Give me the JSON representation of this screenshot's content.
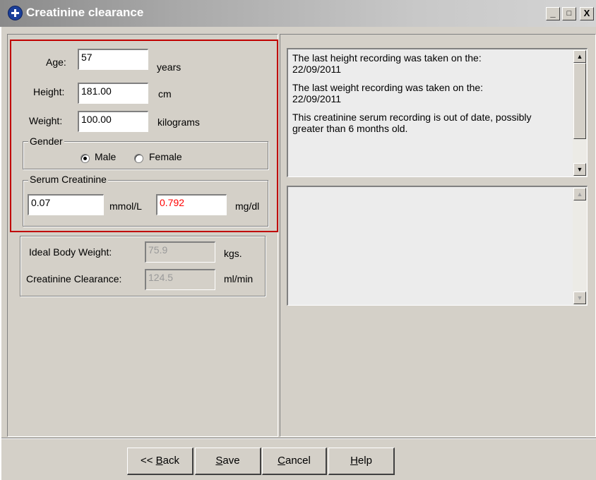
{
  "window": {
    "title": "Creatinine clearance",
    "controls": {
      "minimize": "_",
      "maximize": "□",
      "close": "X"
    }
  },
  "patient": {
    "age_label": "Age:",
    "age_value": "57",
    "age_unit": "years",
    "height_label": "Height:",
    "height_value": "181.00",
    "height_unit": "cm",
    "weight_label": "Weight:",
    "weight_value": "100.00",
    "weight_unit": "kilograms"
  },
  "gender": {
    "title": "Gender",
    "options": [
      "Male",
      "Female"
    ],
    "selected": "Male"
  },
  "serum": {
    "title": "Serum Creatinine",
    "mmol_value": "0.07",
    "mmol_unit": "mmol/L",
    "mg_value": "0.792",
    "mg_unit": "mg/dl",
    "mg_value_color": "#ff0000"
  },
  "results": {
    "ibw_label": "Ideal Body Weight:",
    "ibw_value": "75.9",
    "ibw_unit": "kgs.",
    "crcl_label": "Creatinine Clearance:",
    "crcl_value": "124.5",
    "crcl_unit": "ml/min"
  },
  "messages": {
    "line1": "The last height recording was taken on the:",
    "line1_date": "22/09/2011",
    "line2": "The last weight recording was taken on the:",
    "line2_date": "22/09/2011",
    "line3": "This creatinine serum recording is out of date, possibly greater than 6 months old."
  },
  "buttons": {
    "back": {
      "prefix": "<< ",
      "accel": "B",
      "rest": "ack"
    },
    "save": {
      "prefix": "",
      "accel": "S",
      "rest": "ave"
    },
    "cancel": {
      "prefix": "",
      "accel": "C",
      "rest": "ancel"
    },
    "help": {
      "prefix": "",
      "accel": "H",
      "rest": "elp"
    }
  },
  "colors": {
    "highlight_border": "#c00000",
    "title_bar_text": "#ffffff"
  }
}
